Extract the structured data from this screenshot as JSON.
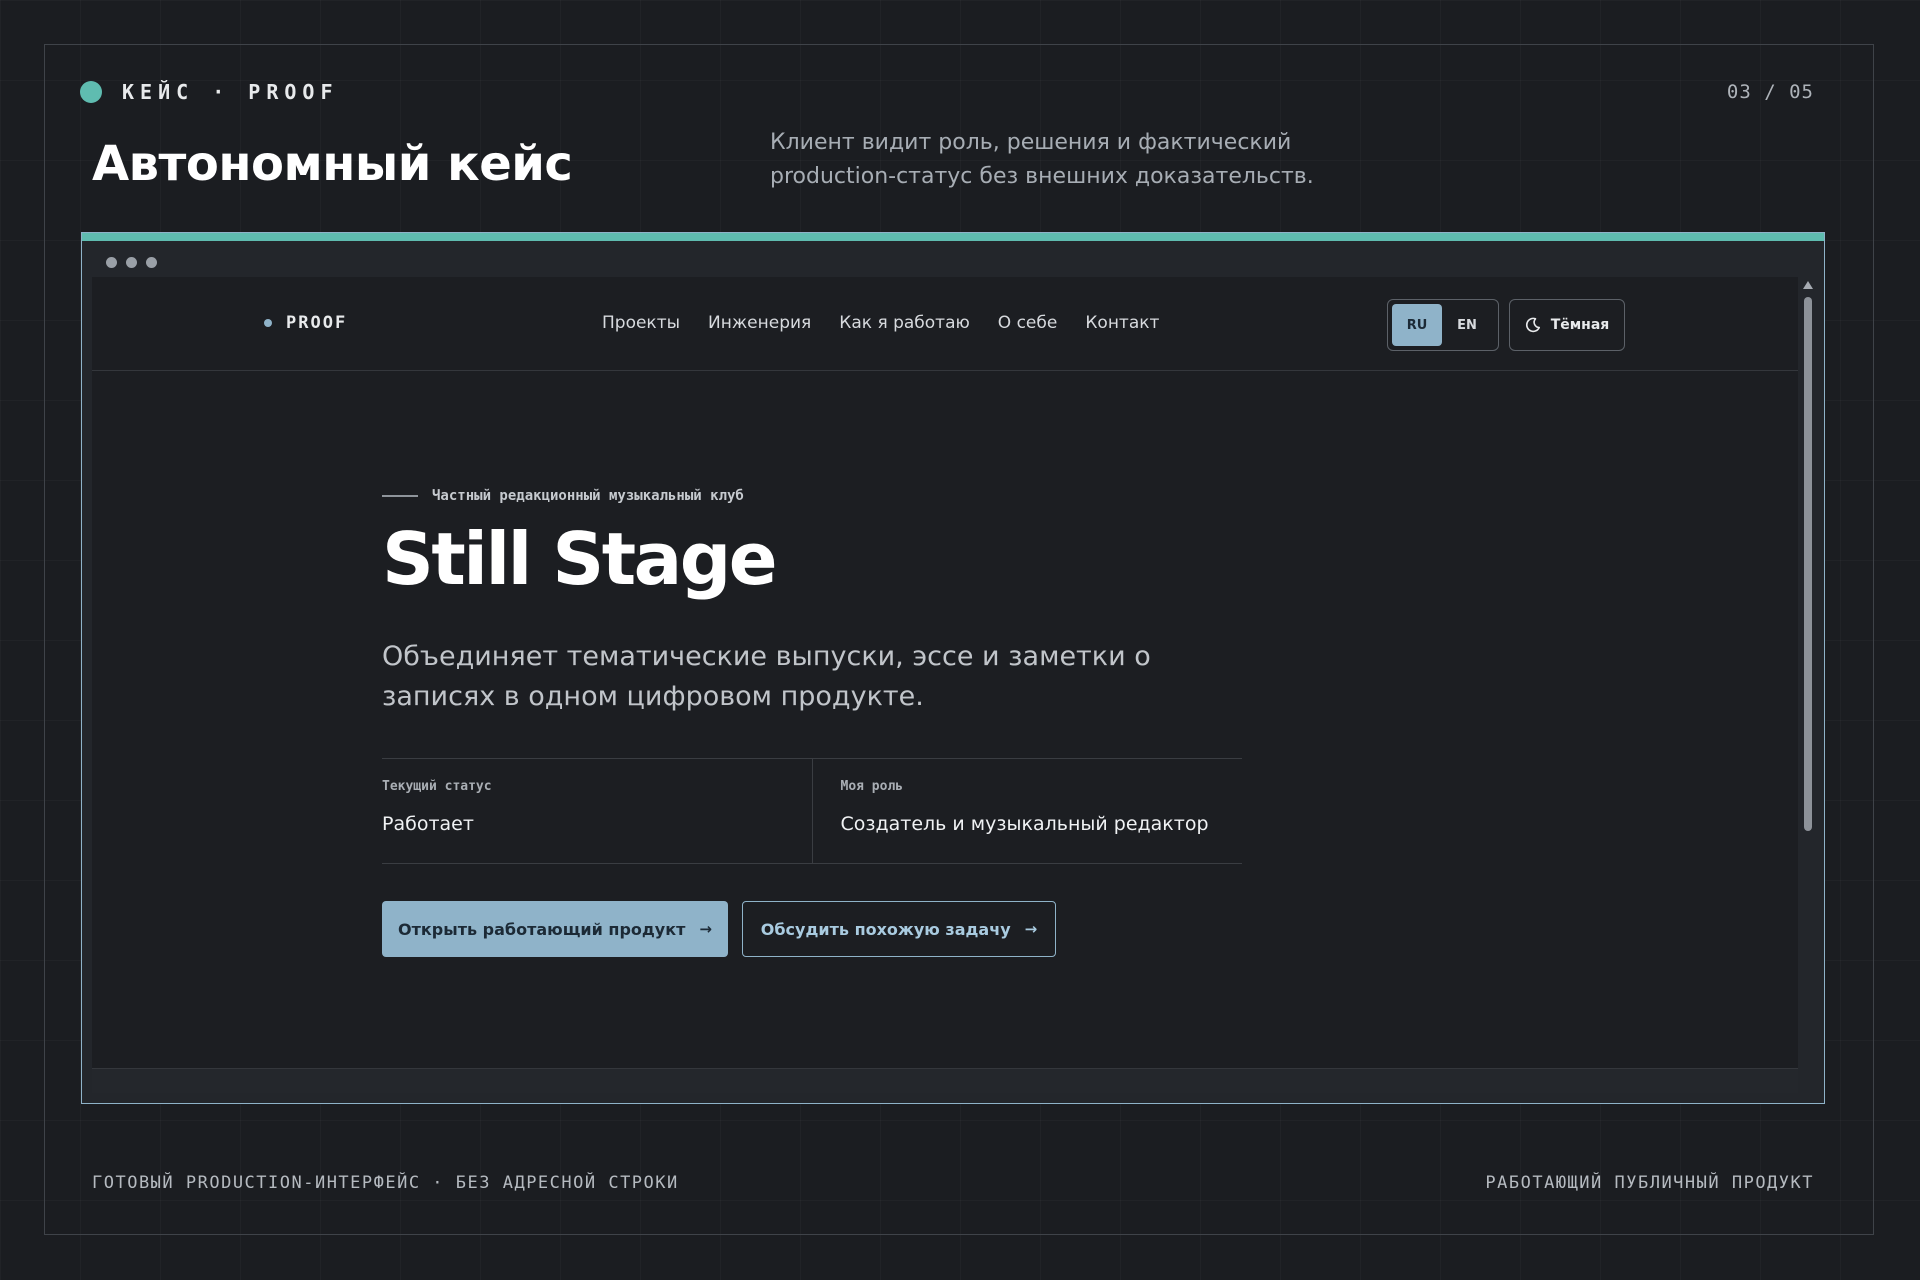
{
  "slide": {
    "brand": "КЕЙС · PROOF",
    "counter": "03 / 05",
    "title": "Автономный кейс",
    "subtitle": "Клиент видит роль, решения и фактический production-статус без внешних доказательств.",
    "footer_left": "ГОТОВЫЙ PRODUCTION-ИНТЕРФЕЙС · БЕЗ АДРЕСНОЙ СТРОКИ",
    "footer_right": "РАБОТАЮЩИЙ ПУБЛИЧНЫЙ ПРОДУКТ"
  },
  "site": {
    "logo": "PROOF",
    "nav": [
      "Проекты",
      "Инженерия",
      "Как я работаю",
      "О себе",
      "Контакт"
    ],
    "lang": {
      "ru": "RU",
      "en": "EN",
      "active": "RU"
    },
    "theme": {
      "label": "Тёмная",
      "icon": "moon-icon"
    }
  },
  "hero": {
    "eyebrow": "Частный редакционный музыкальный клуб",
    "title": "Still Stage",
    "description": "Объединяет тематические выпуски, эссе и заметки о записях в одном цифровом продукте.",
    "facts": [
      {
        "label": "Текущий статус",
        "value": "Работает"
      },
      {
        "label": "Моя роль",
        "value": "Создатель и музыкальный редактор"
      }
    ],
    "primary_cta": "Открыть работающий продукт",
    "secondary_cta": "Обсудить похожую задачу",
    "arrow": "→"
  },
  "colors": {
    "background": "#1b1d21",
    "accent_teal": "#5fbcb0",
    "accent_blue": "#8fb3c9"
  }
}
